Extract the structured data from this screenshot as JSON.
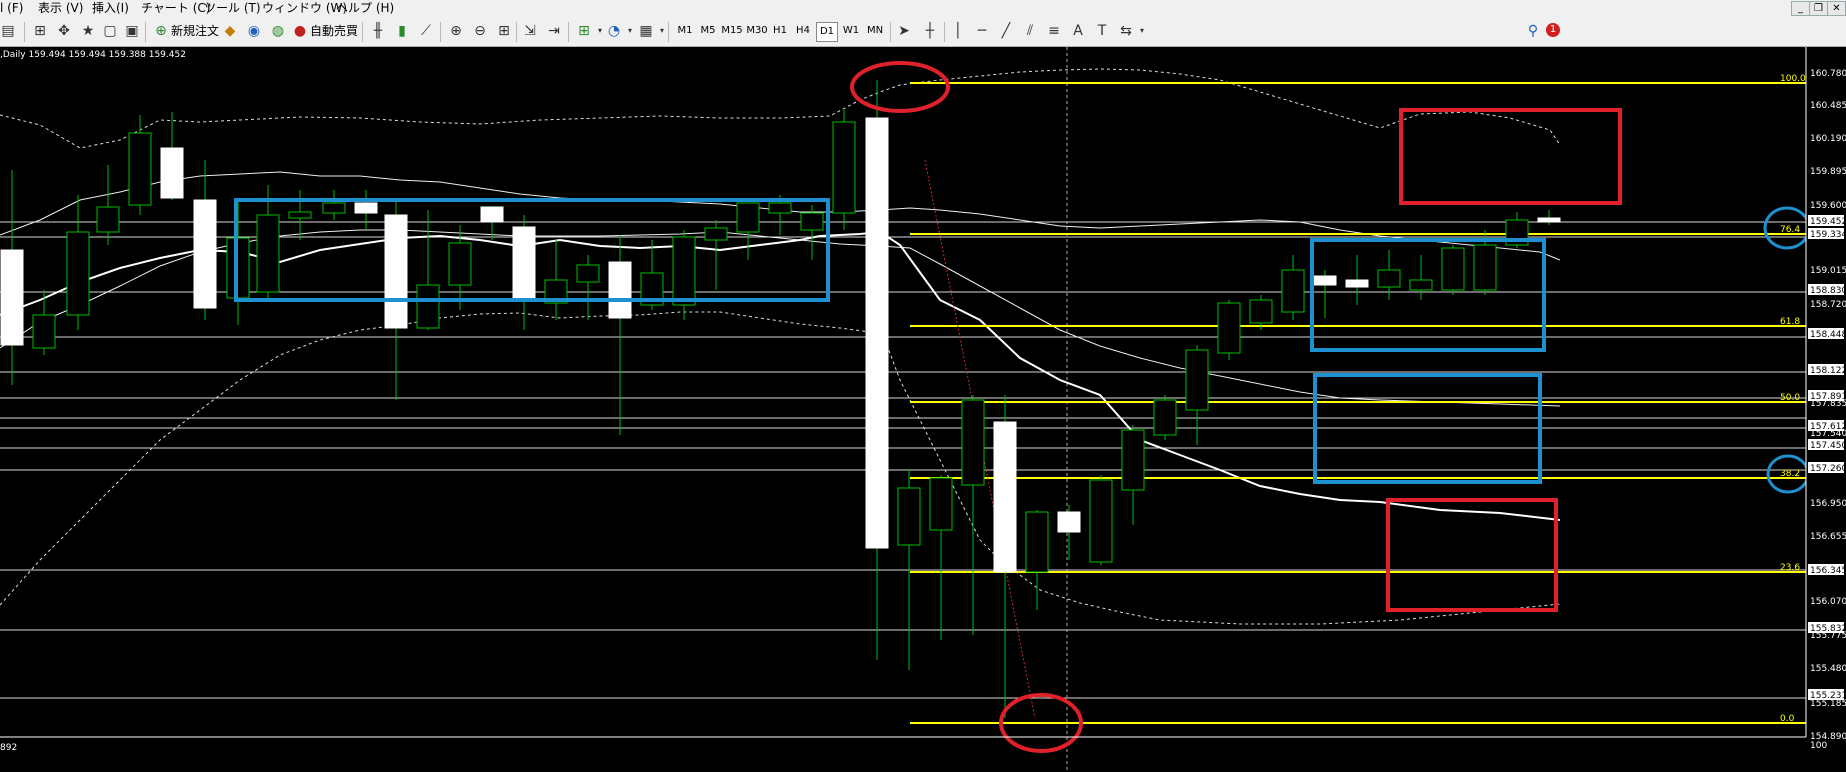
{
  "menubar": {
    "items": [
      "l (F)",
      "表示 (V)",
      "挿入(I)",
      "チャート (C)",
      "ツール (T)",
      "ウィンドウ (W)",
      "ヘルプ (H)"
    ]
  },
  "toolbar": {
    "new_order_label": "新規注文",
    "auto_trade_label": "自動売買",
    "timeframes": [
      "M1",
      "M5",
      "M15",
      "M30",
      "H1",
      "H4",
      "D1",
      "W1",
      "MN"
    ],
    "active_timeframe": "D1"
  },
  "chart": {
    "info_text": ",Daily 159.494 159.494 159.388 159.452",
    "bottom_left_text": "892",
    "price_labels": [
      "160.780",
      "160.485",
      "160.190",
      "159.895",
      "159.600",
      "159.452",
      "159.334",
      "159.015",
      "158.830",
      "158.720",
      "158.448",
      "158.122",
      "157.891",
      "157.835",
      "157.612",
      "157.540",
      "157.450",
      "157.260",
      "156.950",
      "156.655",
      "156.345",
      "156.070",
      "155.832",
      "155.775",
      "155.480",
      "155.231",
      "155.185",
      "154.890",
      "100"
    ],
    "fib_labels": [
      "100.0",
      "76.4",
      "61.8",
      "50.0",
      "38.2",
      "23.6",
      "0.0"
    ],
    "colors": {
      "background": "#000000",
      "candle_up": "#000000",
      "candle_down": "#ffffff",
      "wick": "#00c000",
      "fib": "#ffff00",
      "box_blue": "#1e90d0",
      "box_red": "#e0202a",
      "hline": "#ffffff"
    }
  }
}
